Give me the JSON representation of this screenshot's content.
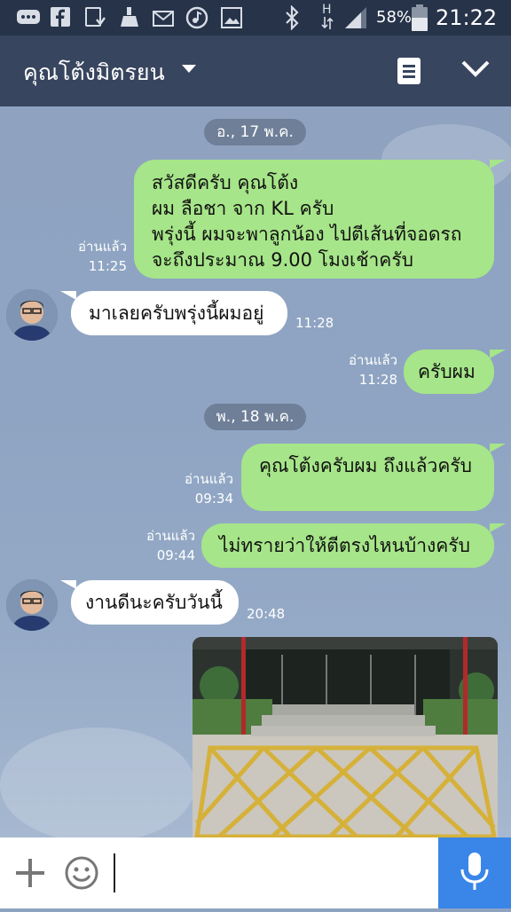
{
  "status_bar": {
    "battery_percent": "58%",
    "time": "21:22",
    "network_type": "H",
    "left_icons": [
      "chat-icon",
      "facebook-icon",
      "download-icon",
      "cleaner-icon",
      "mail-icon",
      "music-icon",
      "gallery-icon"
    ],
    "right_icons": [
      "bluetooth-icon",
      "data-arrows-icon",
      "signal-icon",
      "battery-icon"
    ]
  },
  "header": {
    "title": "คุณโต้งมิตรยน",
    "caret_icon": "dropdown-caret-icon",
    "notes_icon": "notes-icon",
    "collapse_icon": "chevron-down-icon"
  },
  "colors": {
    "header_bg": "#38455f",
    "statusbar_bg": "#263349",
    "outgoing_bubble": "#a6e589",
    "incoming_bubble": "#ffffff",
    "date_pill": "#6f7f98",
    "mic_button": "#3a86e8"
  },
  "messages": {
    "date1": "อ., 17 พ.ค.",
    "m1": {
      "lines": [
        "สวัสดีครับ คุณโต้ง",
        "ผม ลือชา จาก KL ครับ",
        "พรุ่งนี้ ผมจะพาลูกน้อง ไปตีเส้นที่จอดรถ",
        "จะถึงประมาณ 9.00 โมงเช้าครับ"
      ],
      "read": "อ่านแล้ว",
      "time": "11:25"
    },
    "m2": {
      "text": "มาเลยครับพรุ่งนี้ผมอยู่",
      "time": "11:28"
    },
    "m3": {
      "text": "ครับผม",
      "read": "อ่านแล้ว",
      "time": "11:28"
    },
    "date2": "พ., 18 พ.ค.",
    "m4": {
      "text": "คุณโต้งครับผม ถึงแล้วครับ",
      "read": "อ่านแล้ว",
      "time": "09:34"
    },
    "m5": {
      "text": "ไม่ทรายว่าให้ตีตรงไหนบ้างครับ",
      "read": "อ่านแล้ว",
      "time": "09:44"
    },
    "m6": {
      "text": "งานดีนะครับวันนี้",
      "time": "20:48"
    }
  },
  "input_bar": {
    "placeholder": "",
    "value": "",
    "plus_icon": "plus-icon",
    "emoji_icon": "emoji-icon",
    "mic_icon": "microphone-icon"
  }
}
